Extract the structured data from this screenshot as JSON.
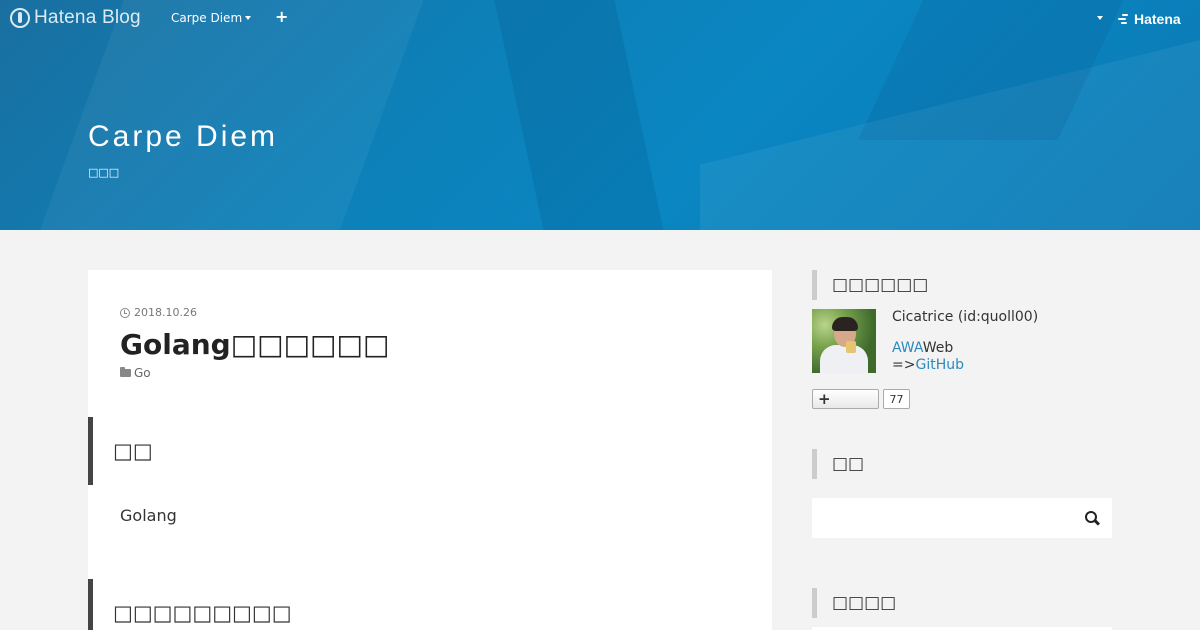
{
  "globalbar": {
    "logo_text": "Hatena Blog",
    "blog_menu_label": "Carpe Diem",
    "add_icon": "plus-icon",
    "hatena_label": "Hatena"
  },
  "header": {
    "blog_title": "Carpe Diem",
    "blog_description": "□□□"
  },
  "entry": {
    "date": "2018.10.26",
    "title": "Golang□□□□□□",
    "category": "Go",
    "sections": [
      {
        "heading": "□□"
      },
      {
        "heading": "□□□□□□□□□"
      }
    ],
    "paragraph": "Golang"
  },
  "sidebar": {
    "profile": {
      "module_title": "□□□□□□",
      "name": "Cicatrice (id:quoll00)",
      "line1_link": "AWA",
      "line1_text": "Web",
      "line2_prefix": "=>",
      "line2_link": "GitHub",
      "follow_count": "77"
    },
    "search": {
      "module_title": "□□",
      "placeholder": ""
    },
    "next_module": {
      "module_title": "□□□□"
    }
  },
  "colors": {
    "header_blue": "#0a86c2",
    "link": "#2a8bbf",
    "section_border": "#444444",
    "sidebar_border": "#cccccc"
  }
}
